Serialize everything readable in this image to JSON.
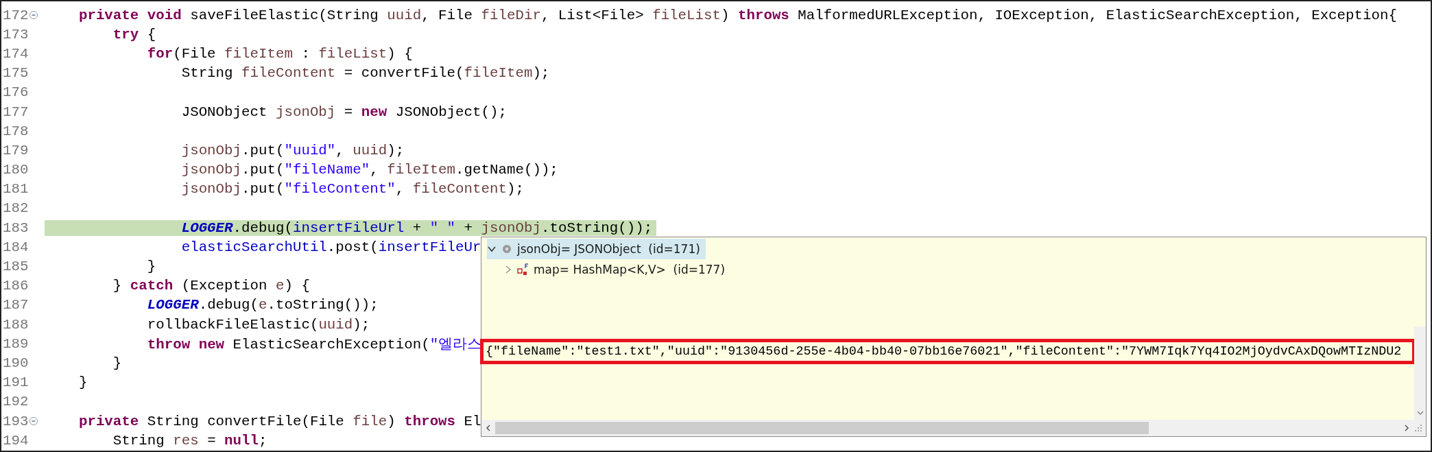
{
  "editor": {
    "lines": [
      {
        "number": "172",
        "fold": true,
        "tokens": [
          {
            "kind": "keyword",
            "text": "    private"
          },
          {
            "kind": "keyword",
            "text": " void"
          },
          {
            "kind": "plain",
            "text": " saveFileElastic(String "
          },
          {
            "kind": "var",
            "text": "uuid"
          },
          {
            "kind": "plain",
            "text": ", File "
          },
          {
            "kind": "var",
            "text": "fileDir"
          },
          {
            "kind": "plain",
            "text": ", List<File> "
          },
          {
            "kind": "var",
            "text": "fileList"
          },
          {
            "kind": "plain",
            "text": ") "
          },
          {
            "kind": "keyword",
            "text": "throws"
          },
          {
            "kind": "plain",
            "text": " MalformedURLException, IOException, ElasticSearchException, Exception{"
          }
        ]
      },
      {
        "number": "173",
        "tokens": [
          {
            "kind": "keyword",
            "text": "        try"
          },
          {
            "kind": "plain",
            "text": " {"
          }
        ]
      },
      {
        "number": "174",
        "tokens": [
          {
            "kind": "keyword",
            "text": "            for"
          },
          {
            "kind": "plain",
            "text": "(File "
          },
          {
            "kind": "var",
            "text": "fileItem"
          },
          {
            "kind": "plain",
            "text": " : "
          },
          {
            "kind": "var",
            "text": "fileList"
          },
          {
            "kind": "plain",
            "text": ") {"
          }
        ]
      },
      {
        "number": "175",
        "tokens": [
          {
            "kind": "plain",
            "text": "                String "
          },
          {
            "kind": "var",
            "text": "fileContent"
          },
          {
            "kind": "plain",
            "text": " = convertFile("
          },
          {
            "kind": "var",
            "text": "fileItem"
          },
          {
            "kind": "plain",
            "text": ");"
          }
        ]
      },
      {
        "number": "176"
      },
      {
        "number": "177",
        "tokens": [
          {
            "kind": "plain",
            "text": "                JSONObject "
          },
          {
            "kind": "var",
            "text": "jsonObj"
          },
          {
            "kind": "plain",
            "text": " = "
          },
          {
            "kind": "keyword",
            "text": "new"
          },
          {
            "kind": "plain",
            "text": " JSONObject();"
          }
        ]
      },
      {
        "number": "178"
      },
      {
        "number": "179",
        "tokens": [
          {
            "kind": "var",
            "text": "                jsonObj"
          },
          {
            "kind": "plain",
            "text": ".put("
          },
          {
            "kind": "string",
            "text": "\"uuid\""
          },
          {
            "kind": "plain",
            "text": ", "
          },
          {
            "kind": "var",
            "text": "uuid"
          },
          {
            "kind": "plain",
            "text": ");"
          }
        ]
      },
      {
        "number": "180",
        "tokens": [
          {
            "kind": "var",
            "text": "                jsonObj"
          },
          {
            "kind": "plain",
            "text": ".put("
          },
          {
            "kind": "string",
            "text": "\"fileName\""
          },
          {
            "kind": "plain",
            "text": ", "
          },
          {
            "kind": "var",
            "text": "fileItem"
          },
          {
            "kind": "plain",
            "text": ".getName());"
          }
        ]
      },
      {
        "number": "181",
        "tokens": [
          {
            "kind": "var",
            "text": "                jsonObj"
          },
          {
            "kind": "plain",
            "text": ".put("
          },
          {
            "kind": "string",
            "text": "\"fileContent\""
          },
          {
            "kind": "plain",
            "text": ", "
          },
          {
            "kind": "var",
            "text": "fileContent"
          },
          {
            "kind": "plain",
            "text": ");"
          }
        ]
      },
      {
        "number": "182"
      },
      {
        "number": "183",
        "current": true,
        "tokens": [
          {
            "kind": "static",
            "text": "                LOGGER"
          },
          {
            "kind": "plain",
            "text": ".debug("
          },
          {
            "kind": "field",
            "text": "insertFileUrl"
          },
          {
            "kind": "plain",
            "text": " + "
          },
          {
            "kind": "string",
            "text": "\" \""
          },
          {
            "kind": "plain",
            "text": " + "
          },
          {
            "kind": "var",
            "text": "jsonObj"
          },
          {
            "kind": "plain",
            "text": ".toString());"
          }
        ]
      },
      {
        "number": "184",
        "tokens": [
          {
            "kind": "field",
            "text": "                elasticSearchUtil"
          },
          {
            "kind": "plain",
            "text": ".post("
          },
          {
            "kind": "field",
            "text": "insertFileUr"
          }
        ]
      },
      {
        "number": "185",
        "tokens": [
          {
            "kind": "plain",
            "text": "            }"
          }
        ]
      },
      {
        "number": "186",
        "tokens": [
          {
            "kind": "plain",
            "text": "        } "
          },
          {
            "kind": "keyword",
            "text": "catch"
          },
          {
            "kind": "plain",
            "text": " (Exception "
          },
          {
            "kind": "var",
            "text": "e"
          },
          {
            "kind": "plain",
            "text": ") {"
          }
        ]
      },
      {
        "number": "187",
        "tokens": [
          {
            "kind": "static",
            "text": "            LOGGER"
          },
          {
            "kind": "plain",
            "text": ".debug("
          },
          {
            "kind": "var",
            "text": "e"
          },
          {
            "kind": "plain",
            "text": ".toString());"
          }
        ]
      },
      {
        "number": "188",
        "tokens": [
          {
            "kind": "plain",
            "text": "            rollbackFileElastic("
          },
          {
            "kind": "var",
            "text": "uuid"
          },
          {
            "kind": "plain",
            "text": ");"
          }
        ]
      },
      {
        "number": "189",
        "tokens": [
          {
            "kind": "keyword",
            "text": "            throw"
          },
          {
            "kind": "keyword",
            "text": " new"
          },
          {
            "kind": "plain",
            "text": " ElasticSearchException("
          },
          {
            "kind": "string",
            "text": "\"엘라스"
          }
        ]
      },
      {
        "number": "190",
        "tokens": [
          {
            "kind": "plain",
            "text": "        }"
          }
        ]
      },
      {
        "number": "191",
        "tokens": [
          {
            "kind": "plain",
            "text": "    }"
          }
        ]
      },
      {
        "number": "192"
      },
      {
        "number": "193",
        "fold": true,
        "tokens": [
          {
            "kind": "keyword",
            "text": "    private"
          },
          {
            "kind": "plain",
            "text": " String convertFile(File "
          },
          {
            "kind": "var",
            "text": "file"
          },
          {
            "kind": "plain",
            "text": ") "
          },
          {
            "kind": "keyword",
            "text": "throws"
          },
          {
            "kind": "plain",
            "text": " El"
          }
        ]
      },
      {
        "number": "194",
        "tokens": [
          {
            "kind": "plain",
            "text": "        String "
          },
          {
            "kind": "var",
            "text": "res"
          },
          {
            "kind": "plain",
            "text": " = "
          },
          {
            "kind": "keyword",
            "text": "null"
          },
          {
            "kind": "plain",
            "text": ";"
          }
        ]
      }
    ]
  },
  "debug_popup": {
    "tree": [
      {
        "kind": "local",
        "label": "jsonObj= JSONObject  (id=171)",
        "expanded": true,
        "selected": true,
        "children": [
          {
            "kind": "field",
            "label": "map= HashMap<K,V>  (id=177)",
            "expanded": false,
            "selected": false
          }
        ]
      }
    ],
    "detail": {
      "text": "{\"fileName\":\"test1.txt\",\"uuid\":\"9130456d-255e-4b04-bb40-07bb16e76021\",\"fileContent\":\"7YWM7Iqk7Yq4IO2MjOydvCAxDQowMTIzNDU2",
      "outlined": true
    }
  }
}
